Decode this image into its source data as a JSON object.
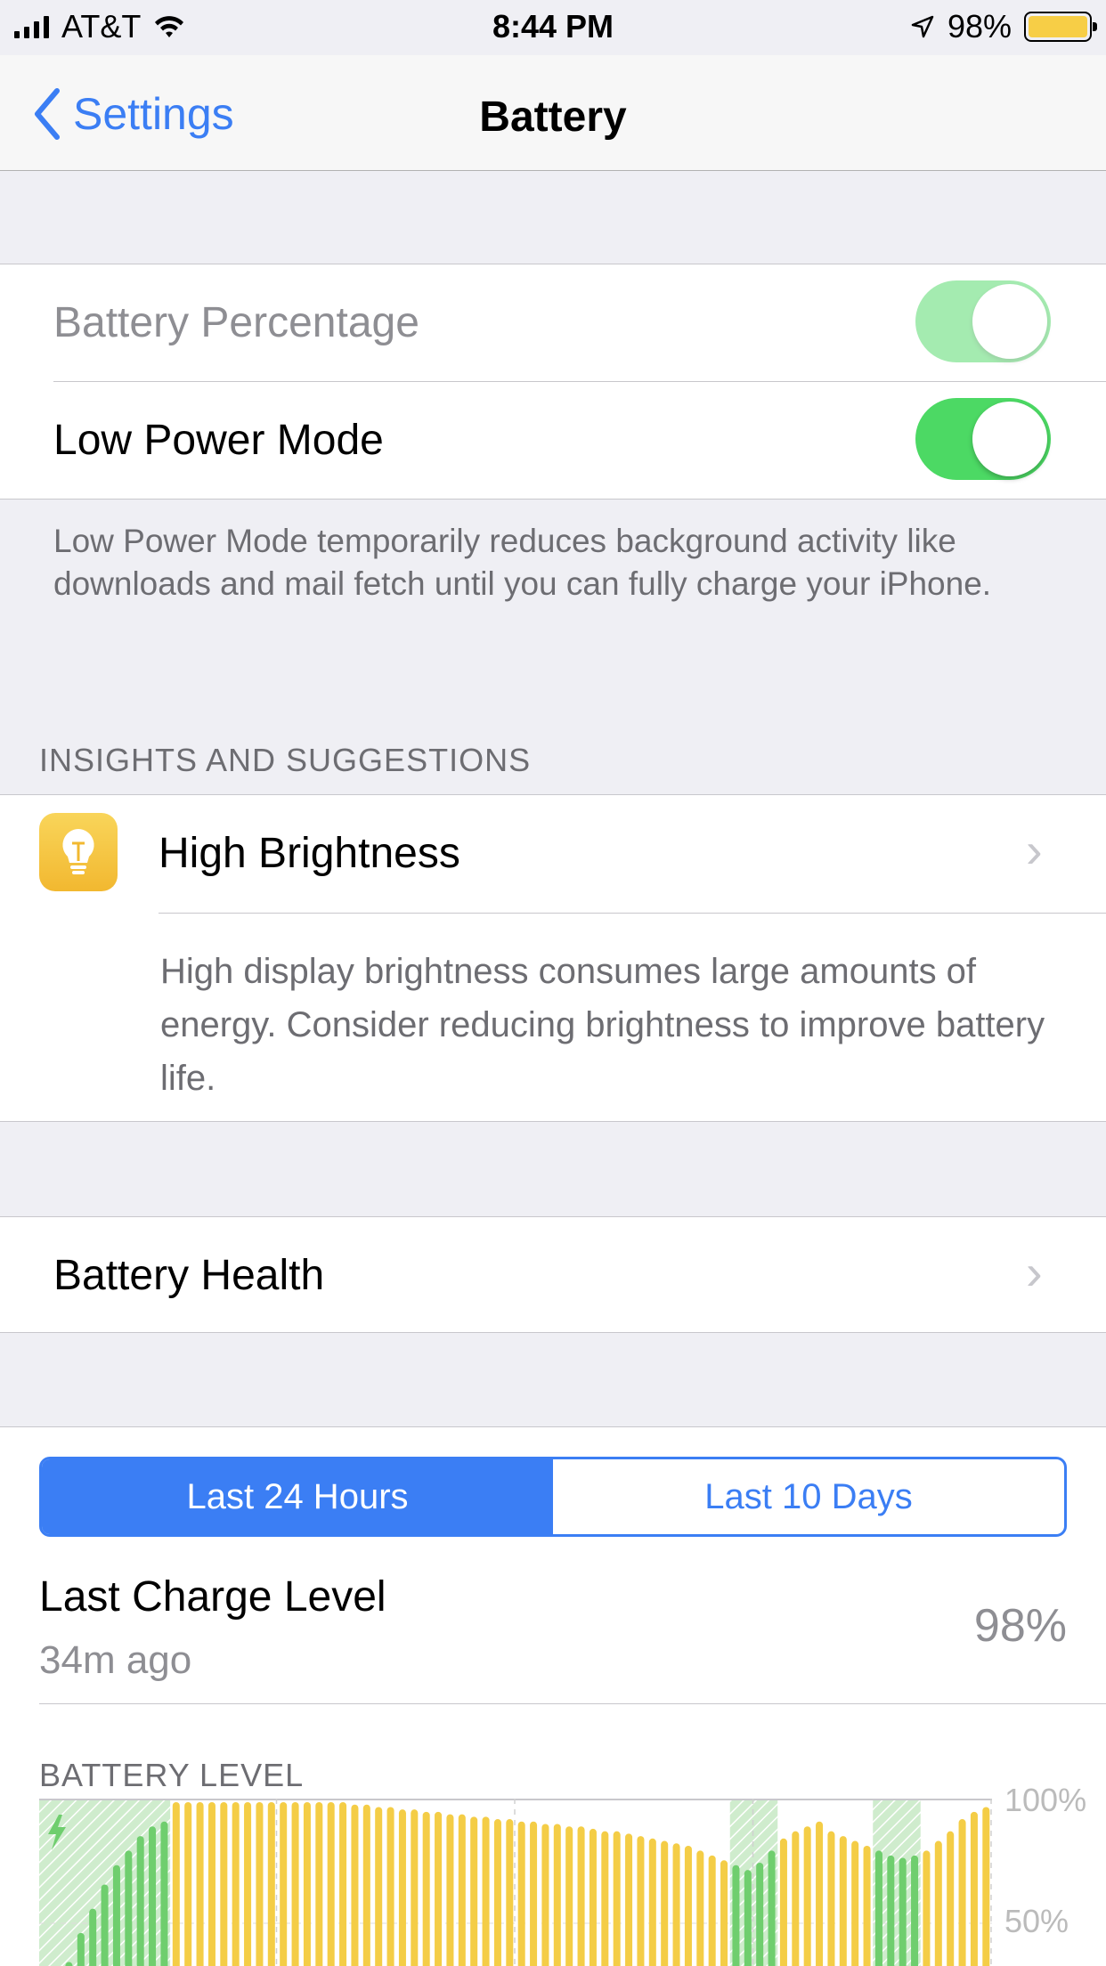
{
  "status": {
    "carrier": "AT&T",
    "time": "8:44 PM",
    "battery_pct": "98%"
  },
  "nav": {
    "back_label": "Settings",
    "title": "Battery"
  },
  "settings": {
    "battery_percentage_label": "Battery Percentage",
    "battery_percentage_on": true,
    "low_power_label": "Low Power Mode",
    "low_power_on": true,
    "low_power_footer": "Low Power Mode temporarily reduces background activity like downloads and mail fetch until you can fully charge your iPhone."
  },
  "insights": {
    "header": "INSIGHTS AND SUGGESTIONS",
    "item_title": "High Brightness",
    "item_description": "High display brightness consumes large amounts of energy. Consider reducing brightness to improve battery life."
  },
  "health": {
    "label": "Battery Health"
  },
  "usage": {
    "tabs": [
      "Last 24 Hours",
      "Last 10 Days"
    ],
    "selected_tab": "Last 24 Hours",
    "last_charge_label": "Last Charge Level",
    "last_charge_time": "34m ago",
    "last_charge_value": "98%",
    "battery_level_header": "BATTERY LEVEL"
  },
  "chart_data": {
    "type": "bar",
    "title": "BATTERY LEVEL",
    "yticks": [
      "100%",
      "50%"
    ],
    "ylim": [
      0,
      100
    ],
    "colors": {
      "discharging": "#f4cd46",
      "charging": "#6fce6e",
      "charging_shade": "#cfeccd"
    },
    "charging_spans": [
      [
        0,
        11
      ],
      [
        58,
        62
      ],
      [
        70,
        74
      ]
    ],
    "values": [
      18,
      26,
      34,
      46,
      56,
      66,
      74,
      80,
      86,
      90,
      92,
      100,
      100,
      100,
      100,
      100,
      100,
      100,
      100,
      100,
      100,
      100,
      100,
      100,
      100,
      100,
      99,
      99,
      98,
      98,
      97,
      97,
      96,
      96,
      95,
      95,
      94,
      94,
      93,
      93,
      92,
      92,
      91,
      91,
      90,
      90,
      89,
      88,
      88,
      87,
      86,
      85,
      84,
      83,
      82,
      80,
      78,
      76,
      74,
      72,
      75,
      80,
      85,
      88,
      90,
      92,
      88,
      86,
      84,
      82,
      80,
      78,
      77,
      78,
      80,
      84,
      88,
      93,
      96,
      98
    ]
  }
}
